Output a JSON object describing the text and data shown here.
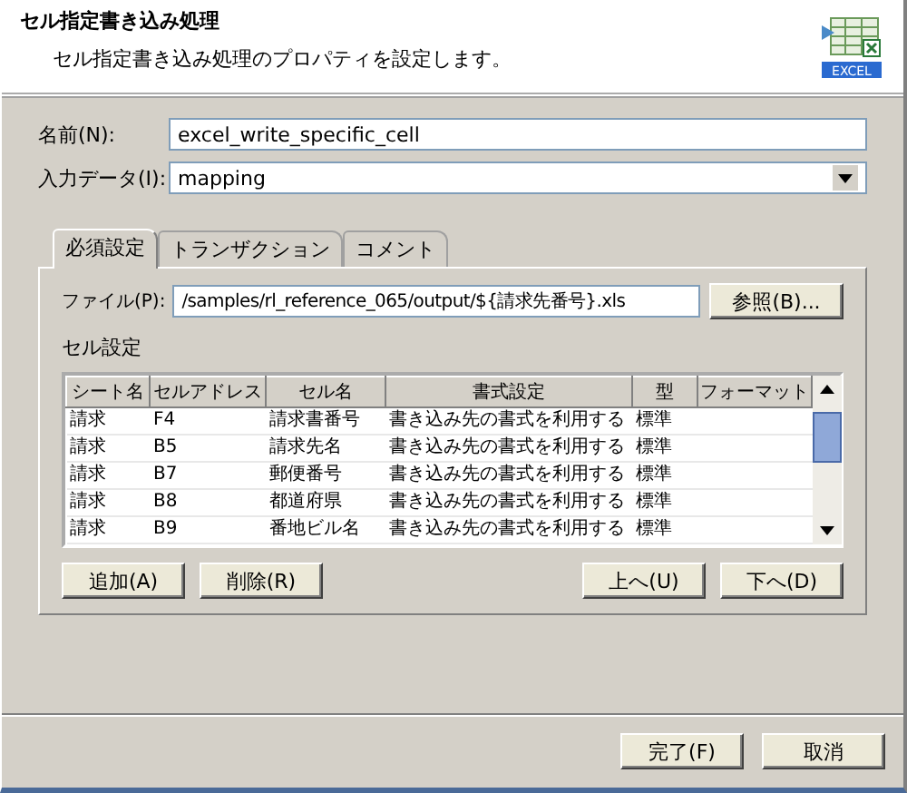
{
  "header": {
    "title": "セル指定書き込み処理",
    "subtitle": "セル指定書き込み処理のプロパティを設定します。",
    "icon_label": "EXCEL"
  },
  "fields": [
    {
      "kind": "text",
      "label": "名前(N):",
      "value": "excel_write_specific_cell"
    },
    {
      "kind": "dropdown",
      "label": "入力データ(I):",
      "value": "mapping"
    }
  ],
  "tabs": [
    {
      "label": "必須設定",
      "selected": true
    },
    {
      "label": "トランザクション",
      "selected": false
    },
    {
      "label": "コメント",
      "selected": false
    }
  ],
  "file": {
    "label": "ファイル(P):",
    "value": "/samples/rl_reference_065/output/${請求先番号}.xls",
    "browse_button": "参照(B)..."
  },
  "cell_settings": {
    "label": "セル設定",
    "columns": [
      "シート名",
      "セルアドレス",
      "セル名",
      "書式設定",
      "型",
      "フォーマット"
    ],
    "rows": [
      [
        "請求",
        "F4",
        "請求書番号",
        "書き込み先の書式を利用する",
        "標準",
        ""
      ],
      [
        "請求",
        "B5",
        "請求先名",
        "書き込み先の書式を利用する",
        "標準",
        ""
      ],
      [
        "請求",
        "B7",
        "郵便番号",
        "書き込み先の書式を利用する",
        "標準",
        ""
      ],
      [
        "請求",
        "B8",
        "都道府県",
        "書き込み先の書式を利用する",
        "標準",
        ""
      ],
      [
        "請求",
        "B9",
        "番地ビル名",
        "書き込み先の書式を利用する",
        "標準",
        ""
      ]
    ],
    "left_buttons": [
      "追加(A)",
      "削除(R)"
    ],
    "right_buttons": [
      "上へ(U)",
      "下へ(D)"
    ]
  },
  "footer_buttons": [
    "完了(F)",
    "取消"
  ]
}
